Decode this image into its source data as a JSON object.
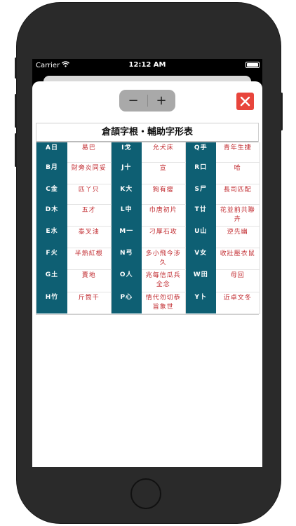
{
  "status_bar": {
    "carrier": "Carrier",
    "time": "12:12 AM"
  },
  "toolbar": {
    "minus_label": "−",
    "plus_label": "+"
  },
  "table": {
    "title": "倉頡字根・輔助字形表",
    "rows": [
      [
        {
          "key": "A日",
          "val": "易巴"
        },
        {
          "key": "I戈",
          "val": "允犬床"
        },
        {
          "key": "Q手",
          "val": "青年生捷"
        }
      ],
      [
        {
          "key": "B月",
          "val": "財旁炎同妥"
        },
        {
          "key": "J十",
          "val": "宣"
        },
        {
          "key": "R口",
          "val": "哈"
        }
      ],
      [
        {
          "key": "C金",
          "val": "匹丫只"
        },
        {
          "key": "K大",
          "val": "狗有瘦"
        },
        {
          "key": "S尸",
          "val": "長司匹配"
        }
      ],
      [
        {
          "key": "D木",
          "val": "五才"
        },
        {
          "key": "L中",
          "val": "巾唐初片"
        },
        {
          "key": "T廿",
          "val": "花並前共聯卉"
        }
      ],
      [
        {
          "key": "E水",
          "val": "泰叉油"
        },
        {
          "key": "M一",
          "val": "刁厚石攻"
        },
        {
          "key": "U山",
          "val": "逆先幽"
        }
      ],
      [
        {
          "key": "F火",
          "val": "半熱紅根"
        },
        {
          "key": "N弓",
          "val": "多小飛今涉久"
        },
        {
          "key": "V女",
          "val": "收壯壓衣鼠"
        }
      ],
      [
        {
          "key": "G土",
          "val": "賣地"
        },
        {
          "key": "O人",
          "val": "兆每信瓜兵全念"
        },
        {
          "key": "W田",
          "val": "母回"
        }
      ],
      [
        {
          "key": "H竹",
          "val": "斤筒千"
        },
        {
          "key": "P心",
          "val": "情代勿切恭旨象世"
        },
        {
          "key": "Y卜",
          "val": "近卓文冬"
        }
      ]
    ]
  },
  "colors": {
    "key_bg": "#0e5f73",
    "glyph_red": "#c0282d",
    "close_red": "#e8453c"
  },
  "icons": {
    "wifi": "wifi-icon",
    "battery": "battery-icon",
    "close": "close-icon"
  }
}
